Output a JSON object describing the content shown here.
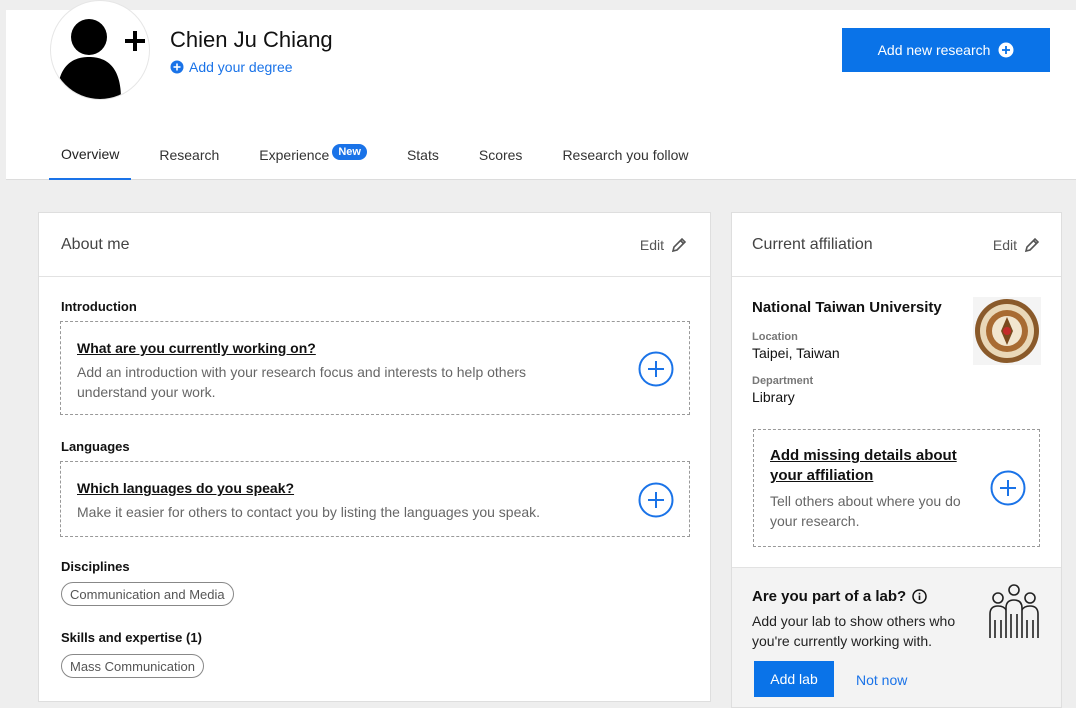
{
  "profile": {
    "name": "Chien Ju Chiang",
    "add_degree": "Add your degree"
  },
  "header": {
    "add_research": "Add new research"
  },
  "tabs": [
    {
      "label": "Overview",
      "active": true
    },
    {
      "label": "Research"
    },
    {
      "label": "Experience",
      "badge": "New"
    },
    {
      "label": "Stats"
    },
    {
      "label": "Scores"
    },
    {
      "label": "Research you follow"
    }
  ],
  "about": {
    "title": "About me",
    "edit": "Edit",
    "introduction": {
      "label": "Introduction",
      "prompt": "What are you currently working on?",
      "description": "Add an introduction with your research focus and interests to help others understand your work."
    },
    "languages": {
      "label": "Languages",
      "prompt": "Which languages do you speak?",
      "description": "Make it easier for others to contact you by listing the languages you speak."
    },
    "disciplines": {
      "label": "Disciplines",
      "items": [
        "Communication and Media"
      ]
    },
    "skills": {
      "label": "Skills and expertise (1)",
      "items": [
        "Mass Communication"
      ]
    }
  },
  "affiliation": {
    "title": "Current affiliation",
    "edit": "Edit",
    "institution": "National Taiwan University",
    "location_label": "Location",
    "location": "Taipei, Taiwan",
    "department_label": "Department",
    "department": "Library",
    "missing": {
      "prompt": "Add missing details about your affiliation",
      "description": "Tell others about where you do your research."
    }
  },
  "lab": {
    "title": "Are you part of a lab?",
    "description": "Add your lab to show others who you're currently working with.",
    "add_button": "Add lab",
    "dismiss": "Not now"
  },
  "colors": {
    "accent": "#1a73e8",
    "button": "#0a73e8",
    "page_bg": "#eeeeee"
  }
}
